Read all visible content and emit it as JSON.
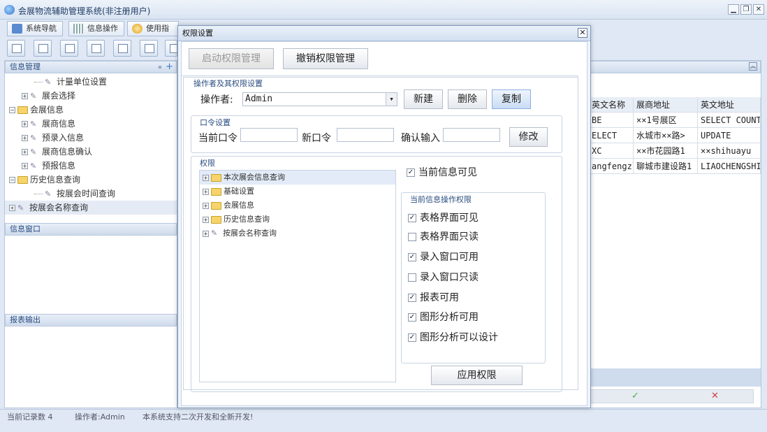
{
  "app": {
    "title": "会展物流辅助管理系统(非注册用户)",
    "tabs": [
      {
        "label": "系统导航"
      },
      {
        "label": "信息操作"
      },
      {
        "label": "使用指南"
      }
    ],
    "window_buttons": [
      "▁",
      "❐",
      "✕"
    ]
  },
  "left": {
    "panel1_title": "信息管理",
    "tree": [
      {
        "label": "计量单位设置",
        "type": "leaf",
        "level": 2,
        "expander": ""
      },
      {
        "label": "展会选择",
        "type": "leaf",
        "level": 1,
        "expander": "+"
      },
      {
        "label": "会展信息",
        "type": "folder",
        "level": 0,
        "expander": "−"
      },
      {
        "label": "展商信息",
        "type": "leaf",
        "level": 1,
        "expander": "+"
      },
      {
        "label": "预录入信息",
        "type": "leaf",
        "level": 1,
        "expander": "+"
      },
      {
        "label": "展商信息确认",
        "type": "leaf",
        "level": 1,
        "expander": "+"
      },
      {
        "label": "预报信息",
        "type": "leaf",
        "level": 1,
        "expander": "+"
      },
      {
        "label": "历史信息查询",
        "type": "folder",
        "level": 0,
        "expander": "−"
      },
      {
        "label": "按展会时间查询",
        "type": "leaf",
        "level": 2,
        "expander": ""
      },
      {
        "label": "按展会名称查询",
        "type": "leaf",
        "level": 0,
        "expander": "+"
      }
    ],
    "panel2_title": "信息窗口",
    "panel3_title": "报表输出"
  },
  "grid": {
    "headers": [
      "英文名称",
      "展商地址",
      "英文地址"
    ],
    "rows": [
      [
        "BE",
        "××1号展区",
        "SELECT COUNT"
      ],
      [
        "ELECT",
        "水城市××路>",
        "UPDATE"
      ],
      [
        "XC",
        "××市花园路1",
        "××shihuayu"
      ],
      [
        "angfengzl",
        "聊城市建设路1",
        "LIAOCHENGSHI,"
      ]
    ],
    "ok_icon": "✓",
    "cancel_icon": "✕"
  },
  "status": {
    "records": "当前记录数 4",
    "operator": "操作者:Admin",
    "note": "本系统支持二次开发和全新开发!"
  },
  "dialog": {
    "title": "权限设置",
    "close": "✕",
    "btn_enable": "启动权限管理",
    "btn_revoke": "撤销权限管理",
    "group_operator_title": "操作者及其权限设置",
    "operator_label": "操作者:",
    "operator_value": "Admin",
    "select_arrow": "▾",
    "btn_new": "新建",
    "btn_delete": "删除",
    "btn_copy": "复制",
    "group_password_title": "口令设置",
    "current_pw_label": "当前口令",
    "new_pw_label": "新口令",
    "confirm_label": "确认输入",
    "btn_modify": "修改",
    "group_perm_title": "权限",
    "perm_tree": [
      {
        "label": "本次展会信息查询",
        "type": "folder"
      },
      {
        "label": "基础设置",
        "type": "folder"
      },
      {
        "label": "会展信息",
        "type": "folder"
      },
      {
        "label": "历史信息查询",
        "type": "folder"
      },
      {
        "label": "按展会名称查询",
        "type": "leaf"
      }
    ],
    "visible_label": "当前信息可见",
    "visible_checked": true,
    "ops_title": "当前信息操作权限",
    "ops": [
      {
        "label": "表格界面可见",
        "checked": true
      },
      {
        "label": "表格界面只读",
        "checked": false
      },
      {
        "label": "录入窗口可用",
        "checked": true
      },
      {
        "label": "录入窗口只读",
        "checked": false
      },
      {
        "label": "报表可用",
        "checked": true
      },
      {
        "label": "图形分析可用",
        "checked": true
      },
      {
        "label": "图形分析可以设计",
        "checked": true
      }
    ],
    "btn_apply": "应用权限"
  }
}
